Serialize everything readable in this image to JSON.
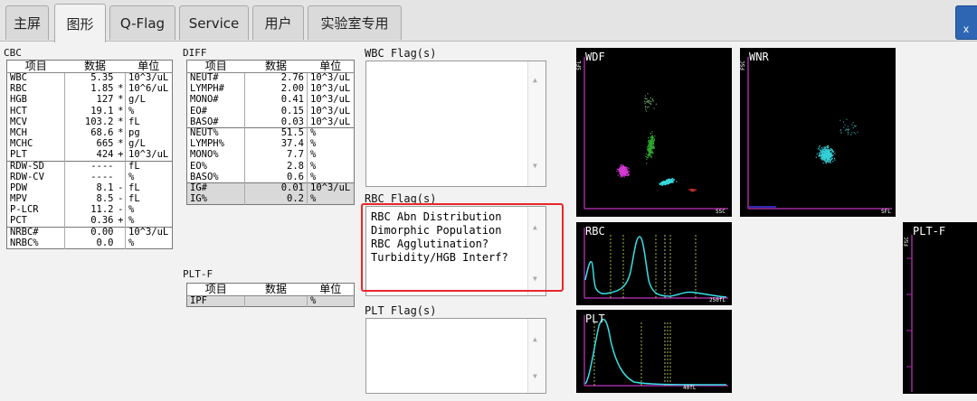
{
  "tabs": [
    {
      "label": "主屏",
      "active": false
    },
    {
      "label": "图形",
      "active": true
    },
    {
      "label": "Q-Flag",
      "active": false
    },
    {
      "label": "Service",
      "active": false
    },
    {
      "label": "用户",
      "active": false
    },
    {
      "label": "实验室专用",
      "active": false
    }
  ],
  "corner_button": "x",
  "cbc": {
    "title": "CBC",
    "headers": [
      "项目",
      "数据",
      "单位"
    ],
    "rows": [
      {
        "item": "WBC",
        "value": "5.35",
        "flag": "",
        "unit": "10^3/uL"
      },
      {
        "item": "RBC",
        "value": "1.85",
        "flag": "*",
        "unit": "10^6/uL"
      },
      {
        "item": "HGB",
        "value": "127",
        "flag": "*",
        "unit": "g/L"
      },
      {
        "item": "HCT",
        "value": "19.1",
        "flag": "*",
        "unit": "%"
      },
      {
        "item": "MCV",
        "value": "103.2",
        "flag": "*",
        "unit": "fL"
      },
      {
        "item": "MCH",
        "value": "68.6",
        "flag": "*",
        "unit": "pg"
      },
      {
        "item": "MCHC",
        "value": "665",
        "flag": "*",
        "unit": "g/L"
      },
      {
        "item": "PLT",
        "value": "424",
        "flag": "+",
        "unit": "10^3/uL"
      },
      {
        "item": "RDW-SD",
        "value": "----",
        "flag": "",
        "unit": "fL"
      },
      {
        "item": "RDW-CV",
        "value": "----",
        "flag": "",
        "unit": "%"
      },
      {
        "item": "PDW",
        "value": "8.1",
        "flag": "-",
        "unit": "fL"
      },
      {
        "item": "MPV",
        "value": "8.5",
        "flag": "-",
        "unit": "fL"
      },
      {
        "item": "P-LCR",
        "value": "11.2",
        "flag": "-",
        "unit": "%"
      },
      {
        "item": "PCT",
        "value": "0.36",
        "flag": "+",
        "unit": "%"
      },
      {
        "item": "NRBC#",
        "value": "0.00",
        "flag": "",
        "unit": "10^3/uL"
      },
      {
        "item": "NRBC%",
        "value": "0.0",
        "flag": "",
        "unit": "%"
      }
    ]
  },
  "diff": {
    "title": "DIFF",
    "headers": [
      "项目",
      "数据",
      "单位"
    ],
    "rows": [
      {
        "item": "NEUT#",
        "value": "2.76",
        "unit": "10^3/uL"
      },
      {
        "item": "LYMPH#",
        "value": "2.00",
        "unit": "10^3/uL"
      },
      {
        "item": "MONO#",
        "value": "0.41",
        "unit": "10^3/uL"
      },
      {
        "item": "EO#",
        "value": "0.15",
        "unit": "10^3/uL"
      },
      {
        "item": "BASO#",
        "value": "0.03",
        "unit": "10^3/uL"
      },
      {
        "item": "NEUT%",
        "value": "51.5",
        "unit": "%"
      },
      {
        "item": "LYMPH%",
        "value": "37.4",
        "unit": "%"
      },
      {
        "item": "MONO%",
        "value": "7.7",
        "unit": "%"
      },
      {
        "item": "EO%",
        "value": "2.8",
        "unit": "%"
      },
      {
        "item": "BASO%",
        "value": "0.6",
        "unit": "%"
      },
      {
        "item": "IG#",
        "value": "0.01",
        "unit": "10^3/uL"
      },
      {
        "item": "IG%",
        "value": "0.2",
        "unit": "%"
      }
    ]
  },
  "pltf": {
    "title": "PLT-F",
    "headers": [
      "项目",
      "数据",
      "单位"
    ],
    "rows": [
      {
        "item": "IPF",
        "value": "",
        "unit": "%"
      }
    ]
  },
  "wbc_flags": {
    "title": "WBC Flag(s)",
    "items": []
  },
  "rbc_flags": {
    "title": "RBC Flag(s)",
    "items": [
      "RBC Abn Distribution",
      "Dimorphic Population",
      "RBC Agglutination?",
      "Turbidity/HGB Interf?"
    ]
  },
  "plt_flags": {
    "title": "PLT Flag(s)",
    "items": []
  },
  "plots": {
    "wdf": {
      "name": "WDF",
      "y_axis": "SFL",
      "x_axis": "SSC"
    },
    "wnr": {
      "name": "WNR",
      "y_axis": "FSC",
      "x_axis": "SFL"
    },
    "rbc": {
      "name": "RBC",
      "x_max": "250fL"
    },
    "plt": {
      "name": "PLT",
      "x_max": "40fL"
    },
    "pltf": {
      "name": "PLT-F",
      "y_axis": "FSC"
    }
  },
  "colors": {
    "magenta_axis": "#a12aa1",
    "highlight": "#e8262a",
    "curve": "#37e0e6",
    "marker": "#c8e64a"
  }
}
